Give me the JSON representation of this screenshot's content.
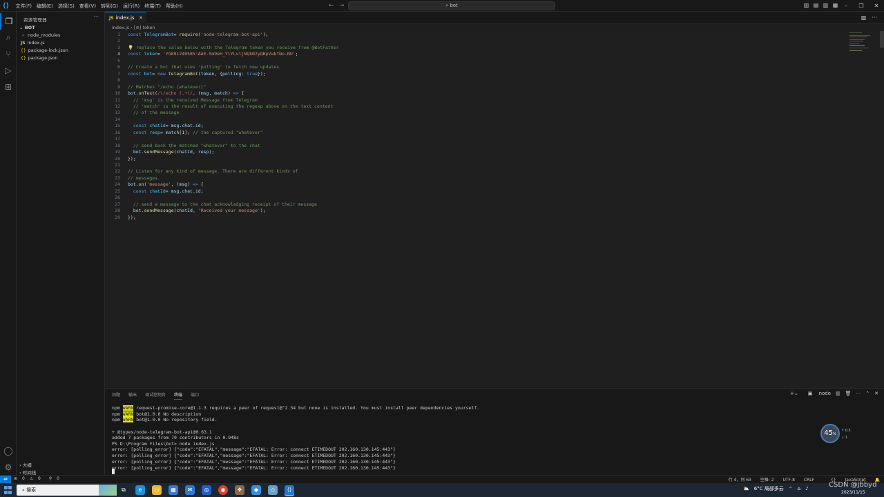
{
  "menubar": {
    "items": [
      "文件(F)",
      "编辑(E)",
      "选择(S)",
      "查看(V)",
      "转到(G)",
      "运行(R)",
      "终端(T)",
      "帮助(H)"
    ]
  },
  "command_center": {
    "text": "bot"
  },
  "sidebar": {
    "title": "资源管理器",
    "folder": "BOT",
    "items": [
      {
        "label": "node_modules",
        "type": "folder"
      },
      {
        "label": "index.js",
        "type": "js"
      },
      {
        "label": "package-lock.json",
        "type": "json"
      },
      {
        "label": "package.json",
        "type": "json"
      }
    ],
    "outline": "大纲",
    "timeline": "时间线"
  },
  "tab": {
    "label": "index.js"
  },
  "breadcrumb": {
    "file": "index.js",
    "symbol": "token"
  },
  "editor": {
    "current_line": 4,
    "lines": [
      [
        [
          "k",
          "const "
        ],
        [
          "v",
          "TelegramBot"
        ],
        [
          "",
          "= "
        ],
        [
          "f",
          "require"
        ],
        [
          "",
          "("
        ],
        [
          "s",
          "'node-telegram-bot-api'"
        ],
        [
          "",
          ");"
        ]
      ],
      [],
      [
        [
          "y",
          "💡 "
        ],
        [
          "c",
          "replace the value below with the Telegram token you receive from @BotFather"
        ]
      ],
      [
        [
          "k",
          "const "
        ],
        [
          "v",
          "token"
        ],
        [
          "",
          "= "
        ],
        [
          "s",
          "'YG891240585:AAE-Sm9eH_YlYLvljNQkN2yQBpVwkfNo-NU'"
        ],
        [
          "",
          ";"
        ]
      ],
      [],
      [
        [
          "c",
          "// Create a bot that uses 'polling' to fetch new updates"
        ]
      ],
      [
        [
          "k",
          "const "
        ],
        [
          "v",
          "bot"
        ],
        [
          "",
          "= "
        ],
        [
          "k",
          "new "
        ],
        [
          "f",
          "TelegramBot"
        ],
        [
          "",
          "("
        ],
        [
          "p",
          "token"
        ],
        [
          "",
          ", {"
        ],
        [
          "p",
          "polling"
        ],
        [
          "",
          ": "
        ],
        [
          "k",
          "true"
        ],
        [
          "",
          "});"
        ]
      ],
      [],
      [
        [
          "c",
          "// Matches \"/echo [whatever]\""
        ]
      ],
      [
        [
          "p",
          "bot"
        ],
        [
          "",
          "."
        ],
        [
          "f",
          "onText"
        ],
        [
          "",
          "("
        ],
        [
          "r",
          "/\\/echo (.+)/"
        ],
        [
          "",
          ", ("
        ],
        [
          "p",
          "msg"
        ],
        [
          "",
          ", "
        ],
        [
          "p",
          "match"
        ],
        [
          "",
          ") "
        ],
        [
          "k",
          "=>"
        ],
        [
          "",
          " {"
        ]
      ],
      [
        [
          "c",
          "  // 'msg' is the received Message from Telegram"
        ]
      ],
      [
        [
          "c",
          "  // 'match' is the result of executing the regexp above on the text content"
        ]
      ],
      [
        [
          "c",
          "  // of the message"
        ]
      ],
      [],
      [
        [
          "",
          "  "
        ],
        [
          "k",
          "const "
        ],
        [
          "v",
          "chatId"
        ],
        [
          "",
          "= "
        ],
        [
          "p",
          "msg"
        ],
        [
          "",
          "."
        ],
        [
          "p",
          "chat"
        ],
        [
          "",
          "."
        ],
        [
          "p",
          "id"
        ],
        [
          "",
          ";"
        ]
      ],
      [
        [
          "",
          "  "
        ],
        [
          "k",
          "const "
        ],
        [
          "v",
          "resp"
        ],
        [
          "",
          "= "
        ],
        [
          "p",
          "match"
        ],
        [
          "",
          "[1]; "
        ],
        [
          "c",
          "// the captured \"whatever\""
        ]
      ],
      [],
      [
        [
          "c",
          "  // send back the matched \"whatever\" to the chat"
        ]
      ],
      [
        [
          "",
          "  "
        ],
        [
          "p",
          "bot"
        ],
        [
          "",
          "."
        ],
        [
          "f",
          "sendMessage"
        ],
        [
          "",
          "("
        ],
        [
          "p",
          "chatId"
        ],
        [
          "",
          ", "
        ],
        [
          "p",
          "resp"
        ],
        [
          "",
          ");"
        ]
      ],
      [
        [
          "",
          "});"
        ]
      ],
      [],
      [
        [
          "c",
          "// Listen for any kind of message. There are different kinds of"
        ]
      ],
      [
        [
          "c",
          "// messages."
        ]
      ],
      [
        [
          "p",
          "bot"
        ],
        [
          "",
          "."
        ],
        [
          "f",
          "on"
        ],
        [
          "",
          "("
        ],
        [
          "s",
          "'message'"
        ],
        [
          "",
          ", ("
        ],
        [
          "p",
          "msg"
        ],
        [
          "",
          ") "
        ],
        [
          "k",
          "=>"
        ],
        [
          "",
          " {"
        ]
      ],
      [
        [
          "",
          "  "
        ],
        [
          "k",
          "const "
        ],
        [
          "v",
          "chatId"
        ],
        [
          "",
          "= "
        ],
        [
          "p",
          "msg"
        ],
        [
          "",
          "."
        ],
        [
          "p",
          "chat"
        ],
        [
          "",
          "."
        ],
        [
          "p",
          "id"
        ],
        [
          "",
          ";"
        ]
      ],
      [],
      [
        [
          "c",
          "  // send a message to the chat acknowledging receipt of their message"
        ]
      ],
      [
        [
          "",
          "  "
        ],
        [
          "p",
          "bot"
        ],
        [
          "",
          "."
        ],
        [
          "f",
          "sendMessage"
        ],
        [
          "",
          "("
        ],
        [
          "p",
          "chatId"
        ],
        [
          "",
          ", "
        ],
        [
          "s",
          "'Received your message'"
        ],
        [
          "",
          ");"
        ]
      ],
      [
        [
          "",
          "});"
        ]
      ]
    ]
  },
  "panel": {
    "tabs": [
      "问题",
      "输出",
      "调试控制台",
      "终端",
      "端口"
    ],
    "active_tab": "终端",
    "shell": "node",
    "terminal_lines": [
      {
        "prefix": "npm ",
        "badge": "WARN",
        "text": " request-promise-core@1.1.3 requires a peer of request@^2.34 but none is installed. You must install peer dependencies yourself."
      },
      {
        "prefix": "npm ",
        "badge": "WARN",
        "text": " bot@1.0.0 No description"
      },
      {
        "prefix": "npm ",
        "badge": "WARN",
        "text": " bot@1.0.0 No repository field."
      },
      {
        "prefix": "",
        "badge": "",
        "text": ""
      },
      {
        "prefix": "",
        "badge": "",
        "text": "+ @types/node-telegram-bot-api@0.63.1"
      },
      {
        "prefix": "",
        "badge": "",
        "text": "added 7 packages from 70 contributors in 0.948s"
      },
      {
        "prefix": "",
        "badge": "",
        "text": "PS D:\\Program Files\\bot> node index.js"
      },
      {
        "prefix": "",
        "badge": "",
        "text": "error: [polling_error] {\"code\":\"EFATAL\",\"message\":\"EFATAL: Error: connect ETIMEDOUT 202.160.130.145:443\"}"
      },
      {
        "prefix": "",
        "badge": "",
        "text": "error: [polling_error] {\"code\":\"EFATAL\",\"message\":\"EFATAL: Error: connect ETIMEDOUT 202.160.130.145:443\"}"
      },
      {
        "prefix": "",
        "badge": "",
        "text": "error: [polling_error] {\"code\":\"EFATAL\",\"message\":\"EFATAL: Error: connect ETIMEDOUT 202.160.130.145:443\"}"
      },
      {
        "prefix": "",
        "badge": "",
        "text": "error: [polling_error] {\"code\":\"EFATAL\",\"message\":\"EFATAL: Error: connect ETIMEDOUT 202.160.130.145:443\"}"
      }
    ]
  },
  "net_widget": {
    "percent": "45",
    "unit": "%",
    "up": "0.5",
    "down": "1"
  },
  "statusbar": {
    "errors": "0",
    "warnings": "0",
    "ports": "0",
    "position": "行 4，列 63",
    "spaces": "空格: 2",
    "encoding": "UTF-8",
    "eol": "CRLF",
    "language": "JavaScript"
  },
  "taskbar": {
    "search_placeholder": "搜索",
    "weather": "6°C  局部多云",
    "time": "",
    "date": "2023/11/15"
  },
  "watermark": "CSDN @jbbyd"
}
